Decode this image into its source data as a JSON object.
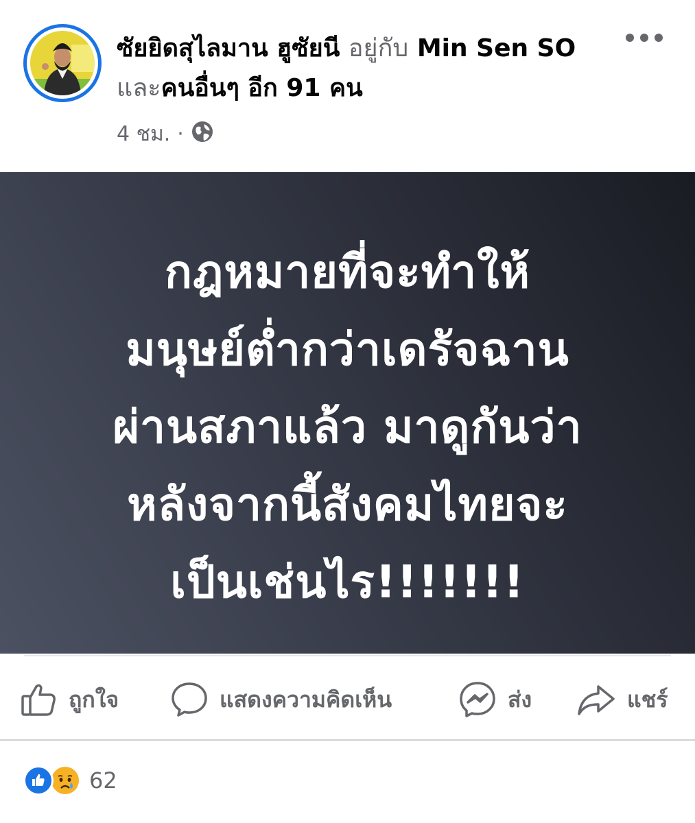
{
  "post": {
    "author_name": "ซัยยิดสุไลมาน ฮูซัยนี",
    "with_text": "อยู่กับ",
    "tagged_name": "Min Sen SO",
    "and_text": "และ",
    "others_text": "คนอื่นๆ อีก 91 คน",
    "timestamp": "4 ชม.",
    "separator": "·",
    "privacy_icon": "globe-icon",
    "more_icon": "ellipsis-icon"
  },
  "image": {
    "lines": [
      "กฎหมายที่จะทำให้",
      "มนุษย์ต่ำกว่าเดรัจฉาน",
      "ผ่านสภาแล้ว มาดูกันว่า",
      "หลังจากนี้สังคมไทยจะ",
      "เป็นเช่นไร!!!!!!!"
    ]
  },
  "actions": {
    "like_label": "ถูกใจ",
    "comment_label": "แสดงความคิดเห็น",
    "send_label": "ส่ง",
    "share_label": "แชร์"
  },
  "reactions": {
    "icons": [
      "like-icon",
      "sad-icon"
    ],
    "count": "62"
  },
  "colors": {
    "accent": "#1b74e4",
    "muted_text": "#65676b",
    "sad_yellow": "#f7b125"
  }
}
